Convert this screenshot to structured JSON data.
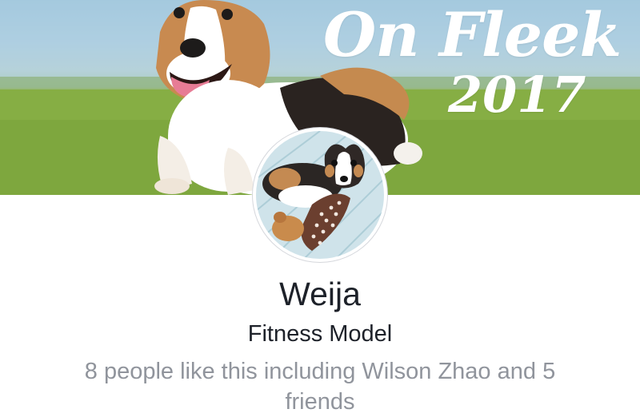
{
  "cover": {
    "title": "On Fleek",
    "year": "2017"
  },
  "profile": {
    "name": "Weija",
    "category": "Fitness Model",
    "like_summary": "8 people like this including Wilson Zhao and 5 friends"
  },
  "colors": {
    "name_text": "#1d2129",
    "secondary_text": "#90949c",
    "avatar_border": "#d5d7dc"
  }
}
